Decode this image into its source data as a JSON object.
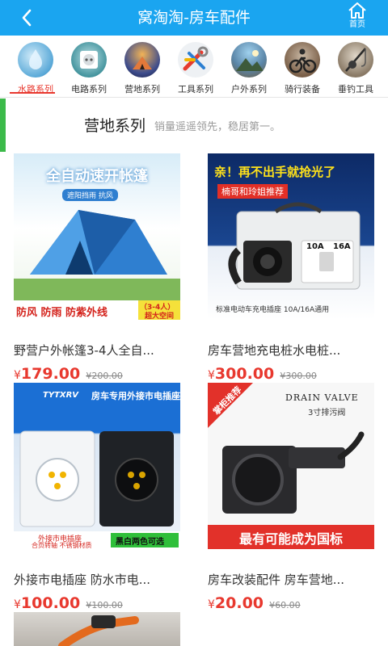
{
  "header": {
    "title": "窝淘淘-房车配件",
    "home_label": "首页"
  },
  "categories": [
    {
      "label": "水路系列",
      "active": true,
      "icon": "water-drop-icon"
    },
    {
      "label": "电路系列",
      "active": false,
      "icon": "power-socket-icon"
    },
    {
      "label": "营地系列",
      "active": false,
      "icon": "campsite-icon"
    },
    {
      "label": "工具系列",
      "active": false,
      "icon": "tools-icon"
    },
    {
      "label": "户外系列",
      "active": false,
      "icon": "outdoor-icon"
    },
    {
      "label": "骑行装备",
      "active": false,
      "icon": "cycling-icon"
    },
    {
      "label": "垂钓工具",
      "active": false,
      "icon": "fishing-icon"
    }
  ],
  "section": {
    "title": "营地系列",
    "subtitle": "销量遥遥领先，稳居第一。"
  },
  "currency": "¥",
  "products": [
    {
      "name": "野营户外帐篷3-4人全自...",
      "price": "179.00",
      "old_price": "200.00",
      "image": {
        "banner": "全自动速开帐篷",
        "tag": "遮阳挡雨 抗风",
        "bottom": "防风 防雨 防紫外线",
        "badge_top": "（3-4人）",
        "badge_bottom": "超大空间"
      }
    },
    {
      "name": "房车营地充电桩水电桩...",
      "price": "300.00",
      "old_price": "300.00",
      "image": {
        "banner": "亲！再不出手就抢光了",
        "sub": "楠哥和玲姐推荐",
        "label_a": "10A",
        "label_b": "16A",
        "caption": "标准电动车充电插座 10A/16A通用"
      }
    },
    {
      "name": "外接市电插座 防水市电...",
      "price": "100.00",
      "old_price": "100.00",
      "image": {
        "brand": "TYTXRV",
        "banner": "房车专用外接市电插座",
        "caption_a": "外接市电插座",
        "caption_b": "合页转轴 不锈钢材质",
        "caption_c": "黑白两色可选"
      }
    },
    {
      "name": "房车改装配件 房车营地...",
      "price": "20.00",
      "old_price": "60.00",
      "image": {
        "ribbon": "掌柜推荐",
        "brand": "DRAIN VALVE",
        "sub": "3寸排污阀",
        "bottom": "最有可能成为国标"
      }
    }
  ],
  "colors": {
    "header": "#1aa5f0",
    "accent_red": "#e8382e",
    "section_bar": "#3cba4a"
  }
}
